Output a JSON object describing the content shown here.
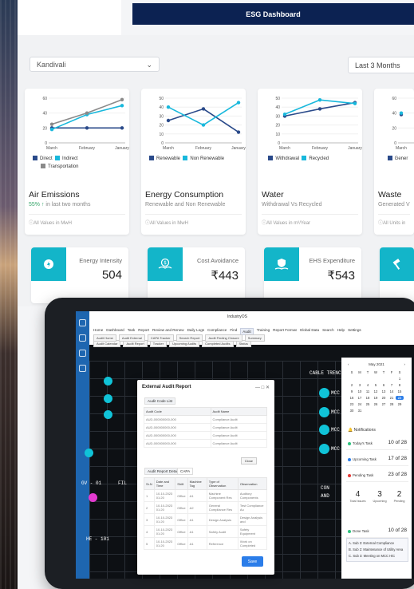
{
  "header": {
    "title": "ESG Dashboard"
  },
  "filters": {
    "location": "Kandivali",
    "range": "Last 3 Months"
  },
  "cards": [
    {
      "title": "Air Emissions",
      "change": "55%",
      "subtitle": "in last two months",
      "footer": "All Values in MwH",
      "legend": [
        "Direct",
        "Indirect",
        "Transportation"
      ]
    },
    {
      "title": "Energy Consumption",
      "subtitle": "Renewable and Non Renewable",
      "footer": "All Values in MwH",
      "legend": [
        "Renewable",
        "Non Renewable"
      ]
    },
    {
      "title": "Water",
      "subtitle": "Withdrawal Vs Recycled",
      "footer": "All Values in m³/Year",
      "legend": [
        "Withdrawal",
        "Recycled"
      ]
    },
    {
      "title": "Waste",
      "subtitle": "Generated V",
      "footer": "All Units in",
      "legend": [
        "Gener"
      ]
    }
  ],
  "chart_data": [
    {
      "type": "line",
      "categories": [
        "March",
        "February",
        "January"
      ],
      "ylim": [
        0,
        60
      ],
      "yticks": [
        0,
        20,
        40,
        60
      ],
      "series": [
        {
          "name": "Direct",
          "values": [
            20,
            20,
            20
          ],
          "color": "#2a4a8a"
        },
        {
          "name": "Indirect",
          "values": [
            18,
            38,
            50
          ],
          "color": "#18b8dc"
        },
        {
          "name": "Transportation",
          "values": [
            25,
            40,
            58
          ],
          "color": "#8a8a8a"
        }
      ]
    },
    {
      "type": "line",
      "categories": [
        "March",
        "February",
        "January"
      ],
      "ylim": [
        0,
        50
      ],
      "yticks": [
        0,
        10,
        20,
        30,
        40,
        50
      ],
      "series": [
        {
          "name": "Renewable",
          "values": [
            25,
            38,
            12
          ],
          "color": "#2a4a8a"
        },
        {
          "name": "Non Renewable",
          "values": [
            40,
            20,
            45
          ],
          "color": "#18b8dc"
        }
      ]
    },
    {
      "type": "line",
      "categories": [
        "March",
        "February",
        "January"
      ],
      "ylim": [
        0,
        50
      ],
      "yticks": [
        0,
        10,
        20,
        30,
        40,
        50
      ],
      "series": [
        {
          "name": "Withdrawal",
          "values": [
            30,
            38,
            45
          ],
          "color": "#2a4a8a"
        },
        {
          "name": "Recycled",
          "values": [
            32,
            48,
            44
          ],
          "color": "#18b8dc"
        }
      ]
    },
    {
      "type": "line",
      "categories": [
        "March"
      ],
      "ylim": [
        0,
        60
      ],
      "yticks": [
        0,
        20,
        40,
        60
      ],
      "series": [
        {
          "name": "Gener",
          "values": [
            38
          ],
          "color": "#2a4a8a"
        },
        {
          "name": "",
          "values": [
            40
          ],
          "color": "#18b8dc"
        }
      ]
    }
  ],
  "kpis": [
    {
      "label": "Energy Intensity",
      "value": "504"
    },
    {
      "label": "Cost Avoidance",
      "value": "₹443"
    },
    {
      "label": "EHS Expenditure",
      "value": "₹543"
    }
  ],
  "tablet": {
    "brand": "IndustryOS",
    "tabs": [
      "Home",
      "Dashboard",
      "Task",
      "Report",
      "Review and Renew",
      "Daily Logs",
      "Compliance",
      "Find",
      "Audit",
      "Training",
      "Report Format",
      "Global Data",
      "Search",
      "Help",
      "Settings"
    ],
    "active_tab": "Audit",
    "subtabs": [
      "Audit Home",
      "Audit External",
      "CAPA Tracker",
      "Search Report",
      "Audit Finding Closure",
      "Summary"
    ],
    "subtabs2": [
      "Audit Calendar",
      "Audit Report",
      "Tracker",
      "Upcoming Audits",
      "Completed Audits",
      "Status"
    ],
    "schematic_labels": [
      "CABLE TRENCH",
      "MCC",
      "MCC",
      "MCC",
      "MCC",
      "GV - 01",
      "FIL",
      "HE - 101",
      "CON",
      "AND"
    ],
    "modal": {
      "title": "External Audit Report",
      "section1": "Audit Code List",
      "cols1": [
        "Audit Code",
        "Audit Name"
      ],
      "rows1": [
        [
          "AUD-000000000-000",
          "Compliance Audit"
        ],
        [
          "AUD-000000000-000",
          "Compliance Audit"
        ],
        [
          "AUD-000000000-000",
          "Compliance Audit"
        ],
        [
          "AUD-000000000-000",
          "Compliance Audit"
        ]
      ],
      "close": "Close",
      "tab_a": "Audit Report Details",
      "tab_b": "CAPA",
      "cols2": [
        "Sr.N",
        "Date and Time",
        "Shift",
        "Machine Tag",
        "Type of Observation",
        "Observation"
      ],
      "rows2": [
        [
          "1",
          "10-10-2023 01:20",
          "Office",
          "A1",
          "Machine Component Res",
          "Auditory Components"
        ],
        [
          "2",
          "10-10-2023 01:20",
          "Office",
          "A2",
          "General Compliance Res",
          "Test Compliance Au"
        ],
        [
          "3",
          "10-10-2023 01:20",
          "Office",
          "A1",
          "Design Analysis",
          "Design Analysis and"
        ],
        [
          "4",
          "10-10-2023 01:20",
          "Office",
          "A1",
          "Safety Audit",
          "Safety Equipment"
        ],
        [
          "5",
          "10-10-2023 01:20",
          "Office",
          "A1",
          "Reference",
          "Work on Completed"
        ]
      ],
      "save": "Save"
    },
    "calendar": {
      "month": "May 2021",
      "days": [
        "S",
        "M",
        "T",
        "W",
        "T",
        "F",
        "S"
      ],
      "dates": [
        "",
        "",
        "",
        "",
        "",
        "",
        "1",
        "2",
        "3",
        "4",
        "5",
        "6",
        "7",
        "8",
        "9",
        "10",
        "11",
        "12",
        "13",
        "14",
        "15",
        "16",
        "17",
        "18",
        "19",
        "20",
        "21",
        "22",
        "23",
        "24",
        "25",
        "26",
        "27",
        "28",
        "29",
        "30",
        "31"
      ],
      "selected": "22"
    },
    "notifications_title": "Notifications",
    "notifications": [
      {
        "label": "Today's Task",
        "count": "10 of 28",
        "color": "#2ec27e"
      },
      {
        "label": "Upcoming Task",
        "count": "17 of 28",
        "color": "#2b7de9"
      },
      {
        "label": "Pending Task",
        "count": "23 of 28",
        "color": "#e53935"
      }
    ],
    "stats": [
      {
        "value": "4",
        "label": "Total Issues"
      },
      {
        "value": "3",
        "label": "Upcoming"
      },
      {
        "value": "2",
        "label": "Pending"
      }
    ],
    "done": {
      "label": "Done Task",
      "count": "10 of 28"
    },
    "tasks": [
      "A. Sub 3: External Compliance",
      "B. Sub 2: Maintenance of Utility Area",
      "C. Sub 3: Meeting on MCC HiC"
    ]
  }
}
